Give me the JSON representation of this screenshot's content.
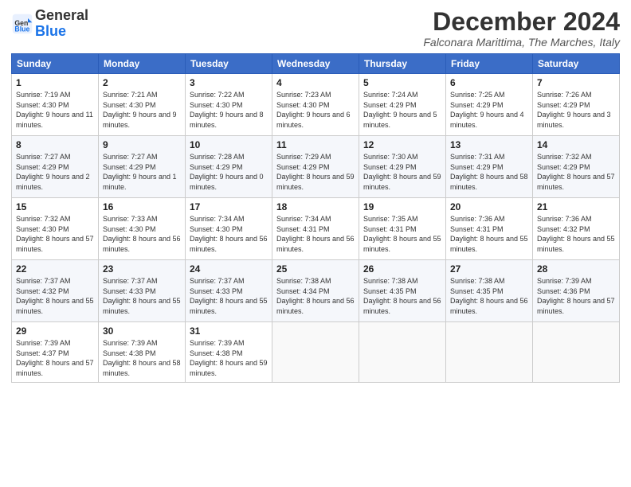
{
  "header": {
    "logo_general": "General",
    "logo_blue": "Blue",
    "month_title": "December 2024",
    "location": "Falconara Marittima, The Marches, Italy"
  },
  "days_of_week": [
    "Sunday",
    "Monday",
    "Tuesday",
    "Wednesday",
    "Thursday",
    "Friday",
    "Saturday"
  ],
  "weeks": [
    [
      {
        "day": "1",
        "sunrise": "7:19 AM",
        "sunset": "4:30 PM",
        "daylight": "9 hours and 11 minutes."
      },
      {
        "day": "2",
        "sunrise": "7:21 AM",
        "sunset": "4:30 PM",
        "daylight": "9 hours and 9 minutes."
      },
      {
        "day": "3",
        "sunrise": "7:22 AM",
        "sunset": "4:30 PM",
        "daylight": "9 hours and 8 minutes."
      },
      {
        "day": "4",
        "sunrise": "7:23 AM",
        "sunset": "4:30 PM",
        "daylight": "9 hours and 6 minutes."
      },
      {
        "day": "5",
        "sunrise": "7:24 AM",
        "sunset": "4:29 PM",
        "daylight": "9 hours and 5 minutes."
      },
      {
        "day": "6",
        "sunrise": "7:25 AM",
        "sunset": "4:29 PM",
        "daylight": "9 hours and 4 minutes."
      },
      {
        "day": "7",
        "sunrise": "7:26 AM",
        "sunset": "4:29 PM",
        "daylight": "9 hours and 3 minutes."
      }
    ],
    [
      {
        "day": "8",
        "sunrise": "7:27 AM",
        "sunset": "4:29 PM",
        "daylight": "9 hours and 2 minutes."
      },
      {
        "day": "9",
        "sunrise": "7:27 AM",
        "sunset": "4:29 PM",
        "daylight": "9 hours and 1 minute."
      },
      {
        "day": "10",
        "sunrise": "7:28 AM",
        "sunset": "4:29 PM",
        "daylight": "9 hours and 0 minutes."
      },
      {
        "day": "11",
        "sunrise": "7:29 AM",
        "sunset": "4:29 PM",
        "daylight": "8 hours and 59 minutes."
      },
      {
        "day": "12",
        "sunrise": "7:30 AM",
        "sunset": "4:29 PM",
        "daylight": "8 hours and 59 minutes."
      },
      {
        "day": "13",
        "sunrise": "7:31 AM",
        "sunset": "4:29 PM",
        "daylight": "8 hours and 58 minutes."
      },
      {
        "day": "14",
        "sunrise": "7:32 AM",
        "sunset": "4:29 PM",
        "daylight": "8 hours and 57 minutes."
      }
    ],
    [
      {
        "day": "15",
        "sunrise": "7:32 AM",
        "sunset": "4:30 PM",
        "daylight": "8 hours and 57 minutes."
      },
      {
        "day": "16",
        "sunrise": "7:33 AM",
        "sunset": "4:30 PM",
        "daylight": "8 hours and 56 minutes."
      },
      {
        "day": "17",
        "sunrise": "7:34 AM",
        "sunset": "4:30 PM",
        "daylight": "8 hours and 56 minutes."
      },
      {
        "day": "18",
        "sunrise": "7:34 AM",
        "sunset": "4:31 PM",
        "daylight": "8 hours and 56 minutes."
      },
      {
        "day": "19",
        "sunrise": "7:35 AM",
        "sunset": "4:31 PM",
        "daylight": "8 hours and 55 minutes."
      },
      {
        "day": "20",
        "sunrise": "7:36 AM",
        "sunset": "4:31 PM",
        "daylight": "8 hours and 55 minutes."
      },
      {
        "day": "21",
        "sunrise": "7:36 AM",
        "sunset": "4:32 PM",
        "daylight": "8 hours and 55 minutes."
      }
    ],
    [
      {
        "day": "22",
        "sunrise": "7:37 AM",
        "sunset": "4:32 PM",
        "daylight": "8 hours and 55 minutes."
      },
      {
        "day": "23",
        "sunrise": "7:37 AM",
        "sunset": "4:33 PM",
        "daylight": "8 hours and 55 minutes."
      },
      {
        "day": "24",
        "sunrise": "7:37 AM",
        "sunset": "4:33 PM",
        "daylight": "8 hours and 55 minutes."
      },
      {
        "day": "25",
        "sunrise": "7:38 AM",
        "sunset": "4:34 PM",
        "daylight": "8 hours and 56 minutes."
      },
      {
        "day": "26",
        "sunrise": "7:38 AM",
        "sunset": "4:35 PM",
        "daylight": "8 hours and 56 minutes."
      },
      {
        "day": "27",
        "sunrise": "7:38 AM",
        "sunset": "4:35 PM",
        "daylight": "8 hours and 56 minutes."
      },
      {
        "day": "28",
        "sunrise": "7:39 AM",
        "sunset": "4:36 PM",
        "daylight": "8 hours and 57 minutes."
      }
    ],
    [
      {
        "day": "29",
        "sunrise": "7:39 AM",
        "sunset": "4:37 PM",
        "daylight": "8 hours and 57 minutes."
      },
      {
        "day": "30",
        "sunrise": "7:39 AM",
        "sunset": "4:38 PM",
        "daylight": "8 hours and 58 minutes."
      },
      {
        "day": "31",
        "sunrise": "7:39 AM",
        "sunset": "4:38 PM",
        "daylight": "8 hours and 59 minutes."
      },
      null,
      null,
      null,
      null
    ]
  ]
}
